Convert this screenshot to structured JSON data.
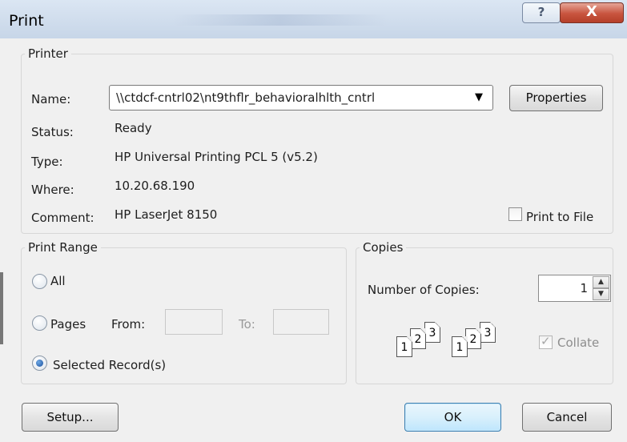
{
  "window": {
    "title": "Print",
    "help_glyph": "?",
    "close_glyph": "X"
  },
  "printer": {
    "group_label": "Printer",
    "name_label": "Name:",
    "name_value": "\\\\ctdcf-cntrl02\\nt9thflr_behavioralhlth_cntrl",
    "properties_label": "Properties",
    "status_label": "Status:",
    "status_value": "Ready",
    "type_label": "Type:",
    "type_value": "HP Universal Printing PCL 5 (v5.2)",
    "where_label": "Where:",
    "where_value": "10.20.68.190",
    "comment_label": "Comment:",
    "comment_value": "HP LaserJet 8150",
    "print_to_file_label": "Print to File",
    "print_to_file_checked": false
  },
  "print_range": {
    "group_label": "Print Range",
    "all_label": "All",
    "pages_label": "Pages",
    "from_label": "From:",
    "to_label": "To:",
    "from_value": "",
    "to_value": "",
    "selected_label": "Selected Record(s)",
    "selected_option": "Selected Record(s)"
  },
  "copies": {
    "group_label": "Copies",
    "number_label": "Number of Copies:",
    "number_value": "1",
    "collate_label": "Collate",
    "collate_checked": true,
    "page_numbers": [
      "1",
      "2",
      "3"
    ]
  },
  "buttons": {
    "setup_label": "Setup...",
    "ok_label": "OK",
    "cancel_label": "Cancel"
  },
  "icons": {
    "dropdown": "chevron-down-icon",
    "spin_up": "spin-up-icon",
    "spin_down": "spin-down-icon",
    "collate": "collate-pages-icon"
  }
}
